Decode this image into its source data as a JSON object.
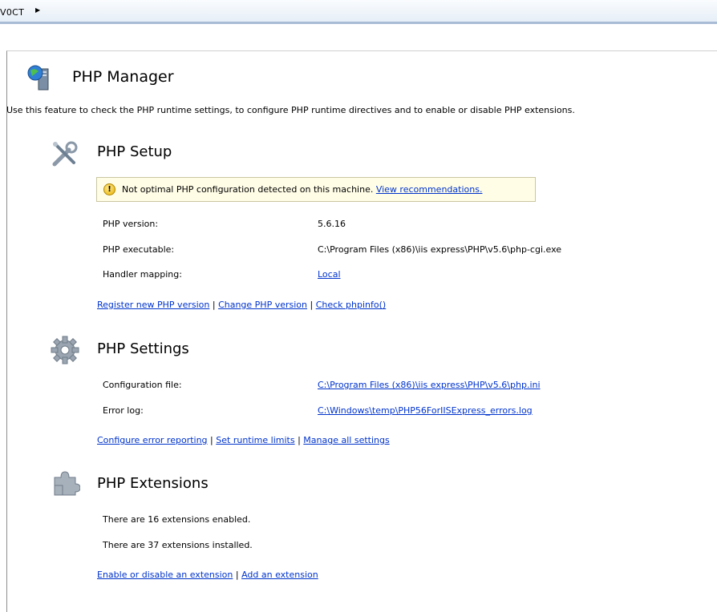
{
  "breadcrumb": {
    "text": "V0CT",
    "arrow": "▶"
  },
  "page": {
    "title": "PHP Manager",
    "description": "Use this feature to check the PHP runtime settings, to configure PHP runtime directives and to enable or disable PHP extensions."
  },
  "setup": {
    "title": "PHP Setup",
    "warning": {
      "text": "Not optimal PHP configuration detected on this machine.",
      "link": "View recommendations."
    },
    "rows": [
      {
        "label": "PHP version:",
        "value": "5.6.16"
      },
      {
        "label": "PHP executable:",
        "value": "C:\\Program Files (x86)\\iis express\\PHP\\v5.6\\php-cgi.exe"
      },
      {
        "label": "Handler mapping:",
        "value": "Local"
      }
    ],
    "links": [
      "Register new PHP version",
      "Change PHP version",
      "Check phpinfo()"
    ]
  },
  "settings": {
    "title": "PHP Settings",
    "rows": [
      {
        "label": "Configuration file:",
        "value": "C:\\Program Files (x86)\\iis express\\PHP\\v5.6\\php.ini"
      },
      {
        "label": "Error log:",
        "value": "C:\\Windows\\temp\\PHP56ForIISExpress_errors.log"
      }
    ],
    "links": [
      "Configure error reporting",
      "Set runtime limits",
      "Manage all settings"
    ]
  },
  "extensions": {
    "title": "PHP Extensions",
    "enabled": "There are 16 extensions enabled.",
    "installed": "There are 37 extensions installed.",
    "links": [
      "Enable or disable an extension",
      "Add an extension"
    ]
  },
  "separator": "|",
  "colors": {
    "link": "#0033cc",
    "warning_bg": "#fffde6",
    "breadcrumb_border": "#a9bcd5"
  },
  "icons": [
    "php-manager-icon",
    "wrench-icon",
    "gear-icon",
    "puzzle-icon",
    "warning-icon",
    "arrow-right-icon"
  ]
}
